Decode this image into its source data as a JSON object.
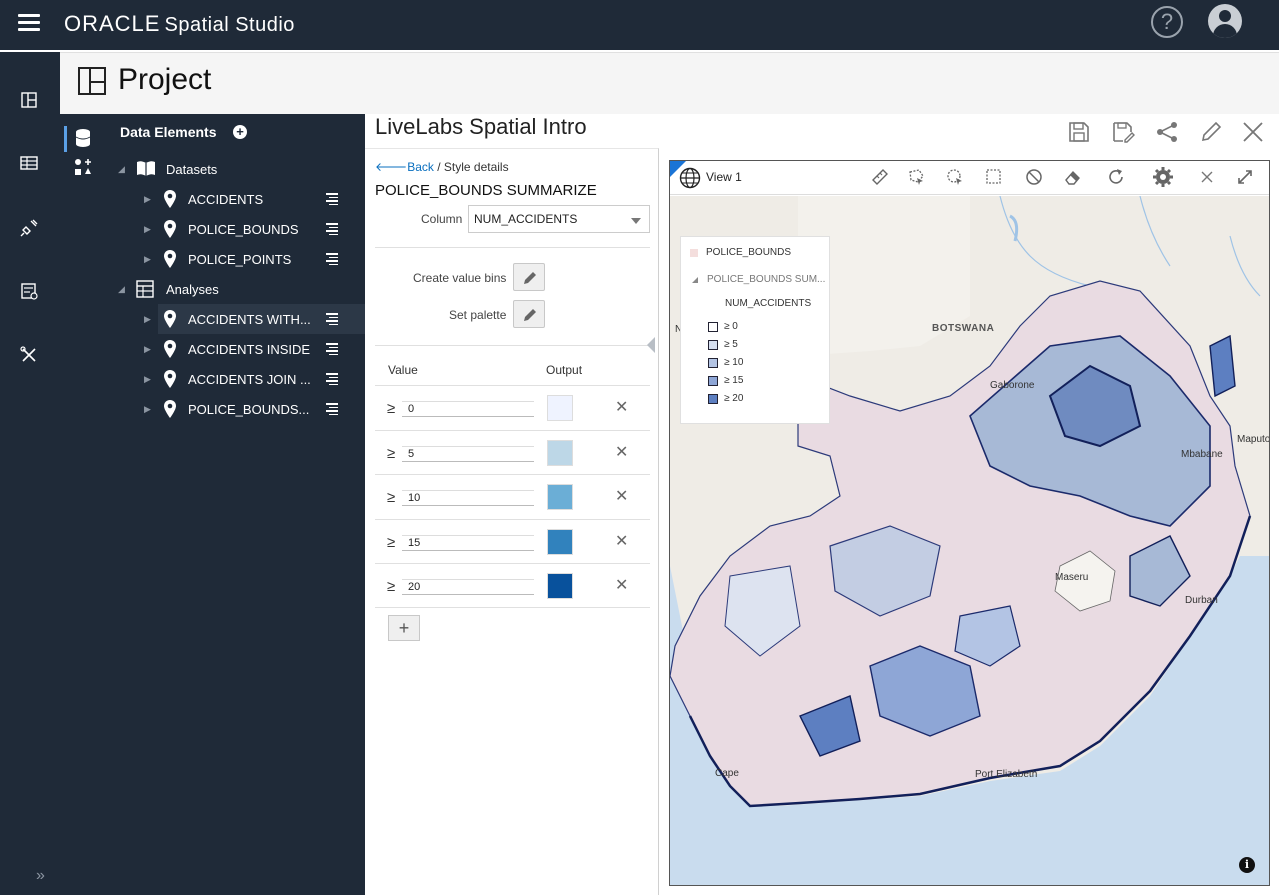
{
  "app": {
    "brand": "ORACLE",
    "product": "Spatial Studio"
  },
  "project": {
    "header": "Project",
    "title": "LiveLabs Spatial Intro"
  },
  "data_elements": {
    "heading": "Data Elements",
    "datasets_label": "Datasets",
    "datasets": [
      "ACCIDENTS",
      "POLICE_BOUNDS",
      "POLICE_POINTS"
    ],
    "analyses_label": "Analyses",
    "analyses": [
      "ACCIDENTS WITH...",
      "ACCIDENTS INSIDE",
      "ACCIDENTS JOIN ...",
      "POLICE_BOUNDS..."
    ]
  },
  "style": {
    "back": "Back",
    "crumb_sep": " / ",
    "crumb": "Style details",
    "title": "POLICE_BOUNDS SUMMARIZE",
    "column_label": "Column",
    "column_value": "NUM_ACCIDENTS",
    "create_bins": "Create value bins",
    "set_palette": "Set palette",
    "value_header": "Value",
    "output_header": "Output",
    "ge": "≥",
    "bins": [
      {
        "value": "0",
        "color": "#eff3ff"
      },
      {
        "value": "5",
        "color": "#bdd7e7"
      },
      {
        "value": "10",
        "color": "#6baed6"
      },
      {
        "value": "15",
        "color": "#3182bd"
      },
      {
        "value": "20",
        "color": "#08519c"
      }
    ],
    "add": "+"
  },
  "map": {
    "view_title": "View 1",
    "legend": {
      "layer1": "POLICE_BOUNDS",
      "layer2": "POLICE_BOUNDS SUM...",
      "field": "NUM_ACCIDENTS",
      "items": [
        "≥ 0",
        "≥ 5",
        "≥ 10",
        "≥ 15",
        "≥ 20"
      ],
      "colors": [
        "#ffffff",
        "#d6dff0",
        "#b3c4e4",
        "#8ea6d6",
        "#5d7fc1"
      ]
    },
    "labels": {
      "botswana": "BOTSWANA",
      "gaborone": "Gaborone",
      "maputo": "Maputo",
      "mbabane": "Mbabane",
      "maseru": "Maseru",
      "durban": "Durban",
      "cape": "Cape",
      "port_elizabeth": "Port Elizabeth",
      "n": "N"
    },
    "info": "i"
  },
  "icons": {
    "menu": "hamburger-icon",
    "help": "help-icon",
    "user": "user-avatar-icon",
    "save": "save-icon",
    "save_as": "save-as-icon",
    "share": "share-icon",
    "edit": "pencil-icon",
    "close": "close-icon"
  }
}
